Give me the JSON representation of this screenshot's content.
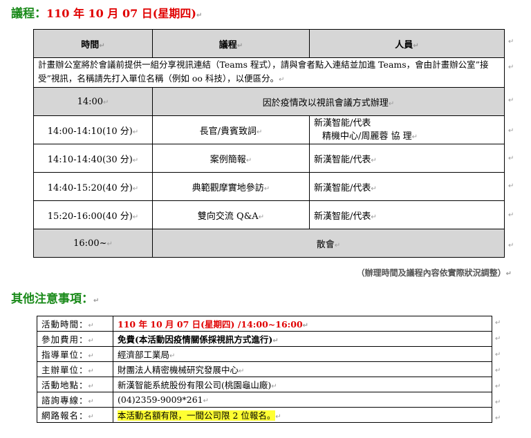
{
  "heading1": {
    "label": "議程：",
    "date": "110 年 10 月 07 日(星期四)"
  },
  "agenda": {
    "headers": [
      "時間",
      "議程",
      "人員"
    ],
    "note": "計畫辦公室將於會議前提供一組分享視訊連結（Teams 程式），請與會者點入連結並加進 Teams，會由計畫辦公室”接受”視訊，名稱請先打入單位名稱（例如 oo 科技），以便區分。",
    "opening": {
      "time": "14:00",
      "item": "因於疫情改以視訊會議方式辦理"
    },
    "rows": [
      {
        "time": "14:00-14:10(10 分)",
        "item": "長官/貴賓致詞",
        "people": [
          "新漢智能/代表",
          "精機中心/周麗蓉 協 理"
        ]
      },
      {
        "time": "14:10-14:40(30 分)",
        "item": "案例簡報",
        "people": [
          "新漢智能/代表"
        ]
      },
      {
        "time": "14:40-15:20(40 分)",
        "item": "典範觀摩實地參訪",
        "people": [
          "新漢智能/代表"
        ]
      },
      {
        "time": "15:20-16:00(40 分)",
        "item": "雙向交流 Q&A",
        "people": [
          "新漢智能/代表"
        ]
      }
    ],
    "closing": {
      "time": "16:00~",
      "item": "散會"
    },
    "adjust_note": "（辦理時間及議程內容依實際狀況調整）"
  },
  "heading2": "其他注意事項：",
  "info": {
    "rows": [
      {
        "key": "活動時間：",
        "value": "110 年 10 月 07 日(星期四) /14:00~16:00"
      },
      {
        "key": "參加費用：",
        "value": "免費(本活動因疫情關係採視訊方式進行)"
      },
      {
        "key": "指導單位：",
        "value": "經濟部工業局"
      },
      {
        "key": "主辦單位：",
        "value": "財團法人精密機械研究發展中心"
      },
      {
        "key": "活動地點：",
        "value": "新漢智能系統股份有限公司(桃園龜山廠)"
      },
      {
        "key": "諮詢專線：",
        "value": "(04)2359-9009*261"
      },
      {
        "key": "網路報名：",
        "value": "本活動名額有限，一間公司限 2 位報名。"
      }
    ]
  },
  "colors": {
    "heading_green": "#1a8a1a",
    "date_red": "#e00000",
    "highlight": "#ffff33",
    "header_gray": "#d6d6d6"
  }
}
